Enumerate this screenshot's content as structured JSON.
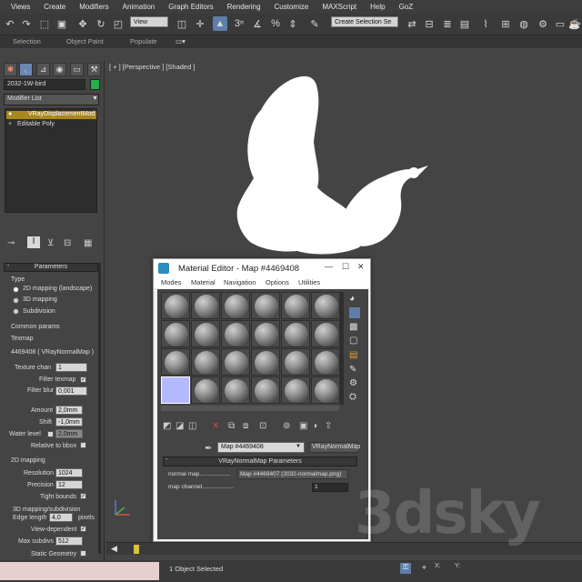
{
  "menu": [
    "Views",
    "Create",
    "Modifiers",
    "Animation",
    "Graph Editors",
    "Rendering",
    "Customize",
    "MAXScript",
    "Help",
    "GoZ"
  ],
  "toolbar": {
    "ref_coord": "View",
    "selection_set": "Create Selection Se"
  },
  "ribbon": [
    "Selection",
    "Object Paint",
    "Populate"
  ],
  "command_panel": {
    "object_name": "2032-1W-bird",
    "object_color": "#22b14c",
    "modifier_list": "Modifier List",
    "stack": [
      "VRayDisplacementMod",
      "Editable Poly"
    ],
    "parameters_title": "Parameters",
    "type_label": "Type",
    "type_options": [
      "2D mapping (landscape)",
      "3D mapping",
      "Subdivision"
    ],
    "common_params": "Common params",
    "texmap_label": "Texmap",
    "texmap_value": "4469408 ( VRayNormalMap )",
    "texture_chan_label": "Texture chan",
    "texture_chan_value": "1",
    "filter_texmap": "Filter texmap",
    "filter_blur_label": "Filter blur",
    "filter_blur_value": "0,001",
    "amount_label": "Amount",
    "amount_value": "2,0mm",
    "shift_label": "Shift",
    "shift_value": "-1,0mm",
    "water_level_label": "Water level",
    "water_level_value": "2,0mm",
    "relative_bbox": "Relative to bbox",
    "mapping_2d": "2D mapping",
    "resolution_label": "Resolution",
    "resolution_value": "1024",
    "precision_label": "Precision",
    "precision_value": "12",
    "tight_bounds": "Tight bounds",
    "mapping_3d": "3D mapping/subdivision",
    "edge_length_label": "Edge length",
    "edge_length_value": "4,0",
    "pixels": "pixels",
    "view_dependent": "View-dependent",
    "max_subdivs_label": "Max subdivs",
    "max_subdivs_value": "512",
    "static_geometry": "Static Geometry"
  },
  "viewport": {
    "label": "[ + ] [Perspective ] [Shaded ]"
  },
  "material_editor": {
    "title": "Material Editor - Map #4469408",
    "menu": [
      "Modes",
      "Material",
      "Navigation",
      "Options",
      "Utilities"
    ],
    "map_name": "Map #4469408",
    "map_type": "VRayNormalMap",
    "params_title": "VRayNormalMap Parameters",
    "normal_map_label": "normal map...................",
    "normal_map_value": "Map #4469407 (2032-normalmap.png)",
    "map_channel_label": "map channel...................",
    "map_channel_value": "1"
  },
  "status": {
    "objects_selected": "1 Object Selected"
  },
  "watermark": "3dsky",
  "colors": {
    "selected_slot": "#b4b8ff",
    "highlight": "#5d7ea8",
    "stack_selected": "#a8871f"
  }
}
